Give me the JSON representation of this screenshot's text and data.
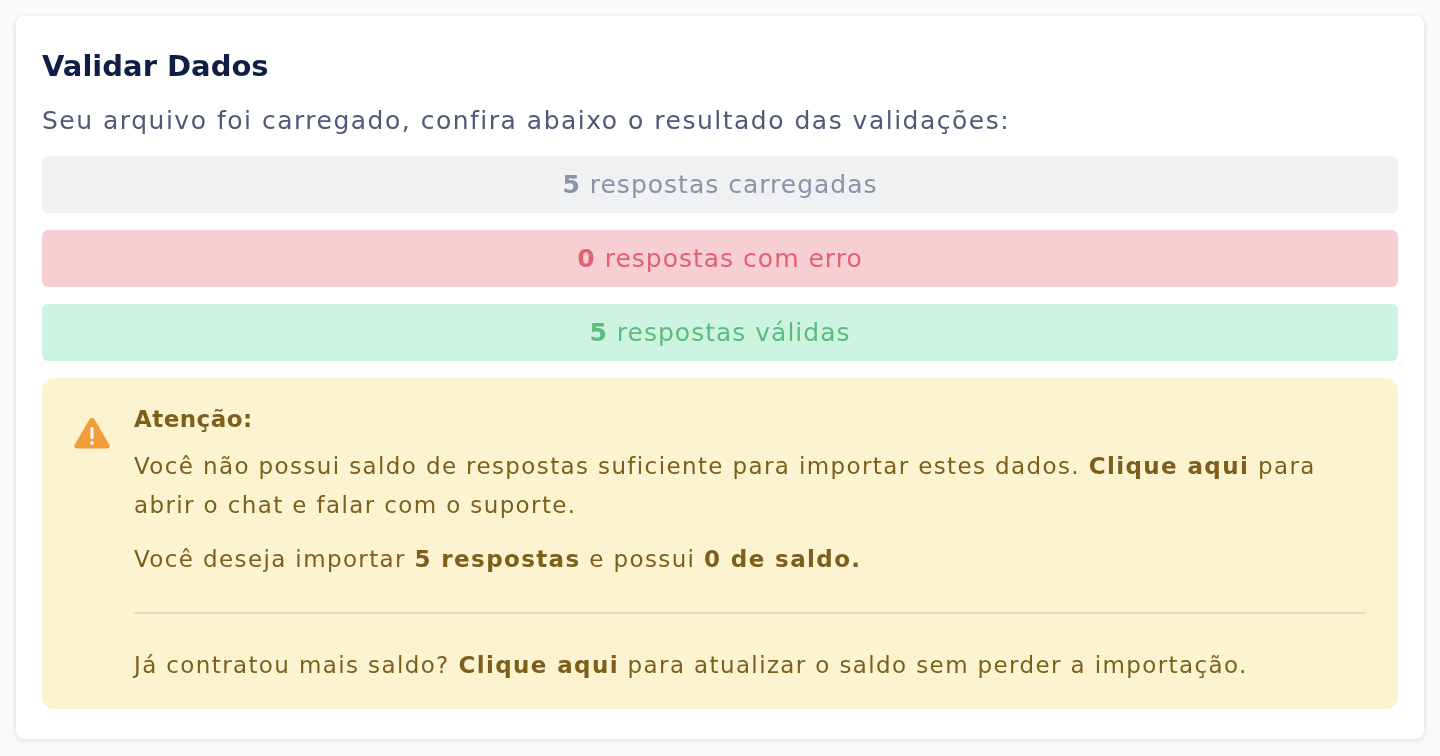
{
  "card": {
    "title": "Validar Dados",
    "subtitle": "Seu arquivo foi carregado, confira abaixo o resultado das validações:"
  },
  "results": [
    {
      "kind": "loaded",
      "count": "5",
      "label": "respostas carregadas"
    },
    {
      "kind": "error",
      "count": "0",
      "label": "respostas com erro"
    },
    {
      "kind": "valid",
      "count": "5",
      "label": "respostas válidas"
    }
  ],
  "alert": {
    "title": "Atenção:",
    "paragraphs": [
      {
        "before": "Você não possui saldo de respostas suficiente para importar estes dados.",
        "link": "Clique aqui",
        "after": "para abrir o chat e falar com o suporte."
      },
      {
        "text": "Você deseja importar **5 respostas** e possui **0 de saldo.**"
      }
    ],
    "footer": {
      "before": "Já contratou mais saldo?",
      "link": "Clique aqui",
      "after": "para atualizar o saldo sem perder a importação."
    }
  }
}
